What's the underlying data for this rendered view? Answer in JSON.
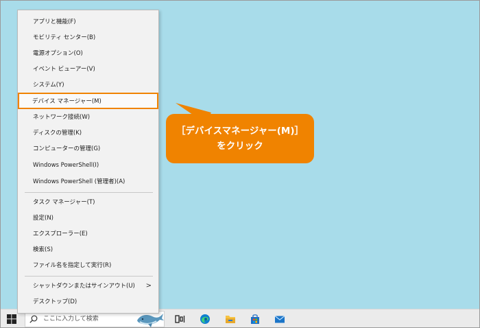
{
  "menu": {
    "items": [
      {
        "label": "アプリと機能(F)"
      },
      {
        "label": "モビリティ センター(B)"
      },
      {
        "label": "電源オプション(O)"
      },
      {
        "label": "イベント ビューアー(V)"
      },
      {
        "label": "システム(Y)"
      },
      {
        "label": "デバイス マネージャー(M)",
        "highlighted": true
      },
      {
        "label": "ネットワーク接続(W)"
      },
      {
        "label": "ディスクの管理(K)"
      },
      {
        "label": "コンピューターの管理(G)"
      },
      {
        "label": "Windows PowerShell(I)"
      },
      {
        "label": "Windows PowerShell (管理者)(A)"
      },
      {
        "label": "タスク マネージャー(T)"
      },
      {
        "label": "設定(N)"
      },
      {
        "label": "エクスプローラー(E)"
      },
      {
        "label": "検索(S)"
      },
      {
        "label": "ファイル名を指定して実行(R)"
      },
      {
        "label": "シャットダウンまたはサインアウト(U)",
        "submenu_arrow": ">"
      },
      {
        "label": "デスクトップ(D)"
      }
    ]
  },
  "callout": {
    "line1": "［デバイスマネージャー(M)］",
    "line2": "をクリック",
    "color": "#f08300"
  },
  "taskbar": {
    "search_placeholder": "ここに入力して検索",
    "icons": [
      "windows-start-icon",
      "search-icon",
      "task-view-icon",
      "edge-icon",
      "file-explorer-icon",
      "store-icon",
      "mail-icon"
    ]
  },
  "colors": {
    "desktop": "#a8dcea",
    "highlight_border": "#f08300"
  }
}
